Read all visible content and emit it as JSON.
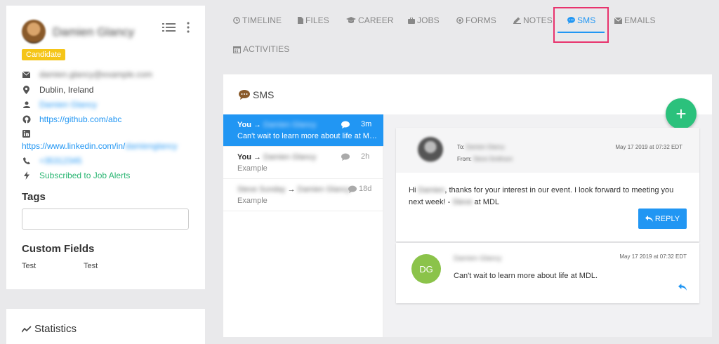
{
  "profile": {
    "name": "Damien Glancy",
    "badge": "Candidate",
    "email": "damien.glancy@example.com",
    "location": "Dublin, Ireland",
    "owner": "Damien Glancy",
    "github": "https://github.com/abc",
    "linkedin_prefix": "https://www.linkedin.com/in/",
    "linkedin_handle": "damienglancy",
    "phone": "+35312345",
    "alerts": "Subscribed to Job Alerts",
    "tags_title": "Tags",
    "custom_fields_title": "Custom Fields",
    "custom_field_name": "Test",
    "custom_field_value": "Test"
  },
  "statistics": {
    "title": "Statistics"
  },
  "tabs": {
    "timeline": "TIMELINE",
    "files": "FILES",
    "career": "CAREER",
    "jobs": "JOBS",
    "forms": "FORMS",
    "notes": "NOTES",
    "sms": "SMS",
    "emails": "EMAILS",
    "activities": "ACTIVITIES"
  },
  "panel": {
    "title": "SMS",
    "add_label": "+"
  },
  "messages": [
    {
      "from": "You",
      "to": "Damien Glancy",
      "time": "3m",
      "preview": "Can't wait to learn more about life at MDL."
    },
    {
      "from": "You",
      "to": "Damien Glancy",
      "time": "2h",
      "preview": "Example"
    },
    {
      "from": "Steve Sunday",
      "to": "Damien Glancy",
      "time": "18d",
      "preview": "Example"
    }
  ],
  "email": {
    "to_label": "To:",
    "to": "Damien Glancy",
    "from_label": "From:",
    "from": "Steve Smithson",
    "date": "May 17 2019 at 07:32 EDT",
    "greeting": "Hi",
    "recipient_first": "Damien",
    "body_1": ", thanks for your interest in our event. I look forward to meeting you next week! - ",
    "signer": "Steve",
    "body_2": " at MDL",
    "reply_label": "REPLY"
  },
  "sms_reply": {
    "initials": "DG",
    "sender": "Damien Glancy",
    "date": "May 17 2019 at 07:32 EDT",
    "text": "Can't wait to learn more about life at MDL."
  },
  "colors": {
    "accent": "#2196f3",
    "success": "#2bc17c",
    "badge": "#f5c518",
    "highlight": "#e8336d"
  }
}
